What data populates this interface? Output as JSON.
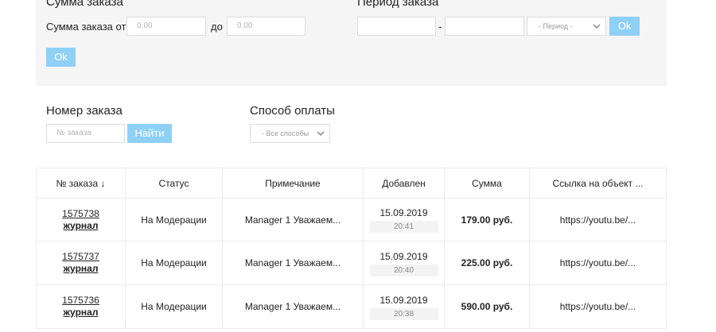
{
  "filters": {
    "order_sum": {
      "title": "Сумма заказа",
      "from_label": "Сумма заказа от",
      "from_placeholder": "0.00",
      "to_label": "до",
      "to_placeholder": "0.00",
      "button": "Ok"
    },
    "order_period": {
      "title": "Период заказа",
      "date_from": "",
      "separator": "-",
      "date_to": "",
      "period_select": "- Период -",
      "button": "Ok"
    },
    "order_number": {
      "title": "Номер заказа",
      "placeholder": "№ заказа",
      "button": "Найти"
    },
    "payment_method": {
      "title": "Способ оплаты",
      "select": "- Все способы"
    }
  },
  "table": {
    "columns": [
      "№ заказа ↓",
      "Статус",
      "Примечание",
      "Добавлен",
      "Сумма",
      "Ссылка на объект ..."
    ],
    "rows": [
      {
        "id": "1575738",
        "type": "журнал",
        "status": "На Модерации",
        "note": "Manager 1 Уважаем...",
        "date": "15.09.2019",
        "time": "20:41",
        "sum": "179.00 руб.",
        "link": "https://youtu.be/..."
      },
      {
        "id": "1575737",
        "type": "журнал",
        "status": "На Модерации",
        "note": "Manager 1 Уважаем...",
        "date": "15.09.2019",
        "time": "20:40",
        "sum": "225.00 руб.",
        "link": "https://youtu.be/..."
      },
      {
        "id": "1575736",
        "type": "журнал",
        "status": "На Модерации",
        "note": "Manager 1 Уважаем...",
        "date": "15.09.2019",
        "time": "20:38",
        "sum": "590.00 руб.",
        "link": "https://youtu.be/..."
      }
    ]
  }
}
